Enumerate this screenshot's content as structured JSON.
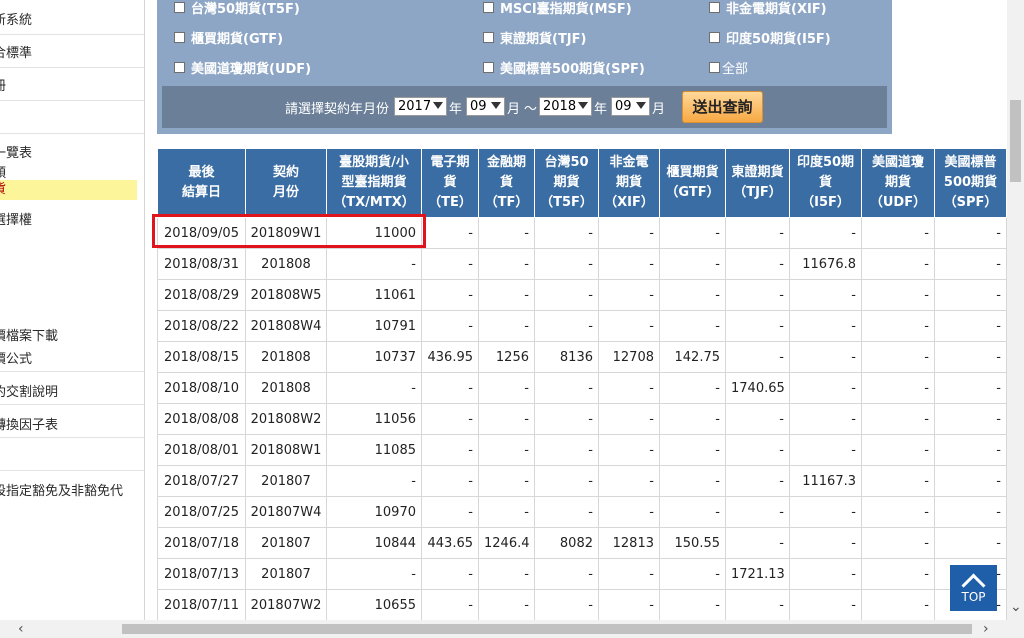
{
  "sidebar": {
    "items": [
      {
        "label": "新系統"
      },
      {
        "label": "合標準"
      },
      {
        "label": "冊"
      },
      {
        "label": "一覽表"
      },
      {
        "label": "類"
      },
      {
        "label": "貨"
      },
      {
        "label": "選擇權"
      },
      {
        "label": "價檔案下載"
      },
      {
        "label": "價公式"
      },
      {
        "label": "約交割說明"
      },
      {
        "label": "轉換因子表"
      },
      {
        "label": "設指定豁免及非豁免代"
      }
    ]
  },
  "filter": {
    "options": [
      {
        "label": "台灣50期貨(T5F)"
      },
      {
        "label": "MSCI臺指期貨(MSF)"
      },
      {
        "label": "非金電期貨(XIF)"
      },
      {
        "label": "櫃買期貨(GTF)"
      },
      {
        "label": "東證期貨(TJF)"
      },
      {
        "label": "印度50期貨(I5F)"
      },
      {
        "label": "美國道瓊期貨(UDF)"
      },
      {
        "label": "美國標普500期貨(SPF)"
      },
      {
        "label": "全部"
      }
    ],
    "date_prompt": "請選擇契約年月份",
    "start_year": "2017",
    "start_month": "09",
    "end_year": "2018",
    "end_month": "09",
    "year_unit": "年",
    "month_unit": "月",
    "tilde": "～",
    "submit_label": "送出查詢"
  },
  "table": {
    "headers": [
      [
        "最後",
        "結算日"
      ],
      [
        "契約",
        "月份"
      ],
      [
        "臺股期貨/小",
        "型臺指期貨",
        "（TX/MTX）"
      ],
      [
        "電子期",
        "貨",
        "（TE）"
      ],
      [
        "金融期",
        "貨",
        "（TF）"
      ],
      [
        "台灣50",
        "期貨",
        "（T5F）"
      ],
      [
        "非金電",
        "期貨",
        "（XIF）"
      ],
      [
        "櫃買期貨",
        "（GTF）"
      ],
      [
        "東證期貨",
        "（TJF）"
      ],
      [
        "印度50期",
        "貨",
        "（I5F）"
      ],
      [
        "美國道瓊",
        "期貨",
        "（UDF）"
      ],
      [
        "美國標普",
        "500期貨",
        "（SPF）"
      ]
    ],
    "rows": [
      [
        "2018/09/05",
        "201809W1",
        "11000",
        "-",
        "-",
        "-",
        "-",
        "-",
        "-",
        "-",
        "-",
        "-"
      ],
      [
        "2018/08/31",
        "201808",
        "-",
        "-",
        "-",
        "-",
        "-",
        "-",
        "-",
        "11676.8",
        "-",
        "-"
      ],
      [
        "2018/08/29",
        "201808W5",
        "11061",
        "-",
        "-",
        "-",
        "-",
        "-",
        "-",
        "-",
        "-",
        "-"
      ],
      [
        "2018/08/22",
        "201808W4",
        "10791",
        "-",
        "-",
        "-",
        "-",
        "-",
        "-",
        "-",
        "-",
        "-"
      ],
      [
        "2018/08/15",
        "201808",
        "10737",
        "436.95",
        "1256",
        "8136",
        "12708",
        "142.75",
        "-",
        "-",
        "-",
        "-"
      ],
      [
        "2018/08/10",
        "201808",
        "-",
        "-",
        "-",
        "-",
        "-",
        "-",
        "1740.65",
        "-",
        "-",
        "-"
      ],
      [
        "2018/08/08",
        "201808W2",
        "11056",
        "-",
        "-",
        "-",
        "-",
        "-",
        "-",
        "-",
        "-",
        "-"
      ],
      [
        "2018/08/01",
        "201808W1",
        "11085",
        "-",
        "-",
        "-",
        "-",
        "-",
        "-",
        "-",
        "-",
        "-"
      ],
      [
        "2018/07/27",
        "201807",
        "-",
        "-",
        "-",
        "-",
        "-",
        "-",
        "-",
        "11167.3",
        "-",
        "-"
      ],
      [
        "2018/07/25",
        "201807W4",
        "10970",
        "-",
        "-",
        "-",
        "-",
        "-",
        "-",
        "-",
        "-",
        "-"
      ],
      [
        "2018/07/18",
        "201807",
        "10844",
        "443.65",
        "1246.4",
        "8082",
        "12813",
        "150.55",
        "-",
        "-",
        "-",
        "-"
      ],
      [
        "2018/07/13",
        "201807",
        "-",
        "-",
        "-",
        "-",
        "-",
        "-",
        "1721.13",
        "-",
        "-",
        "-"
      ],
      [
        "2018/07/11",
        "201807W2",
        "10655",
        "-",
        "-",
        "-",
        "-",
        "-",
        "-",
        "-",
        "-",
        "-"
      ]
    ]
  },
  "top_button": {
    "label": "TOP"
  },
  "colors": {
    "header_bg": "#3a6da3",
    "filter_bg": "#8ea6c5",
    "highlight": "#e0141c",
    "active_item_bg": "#fcf59a"
  }
}
